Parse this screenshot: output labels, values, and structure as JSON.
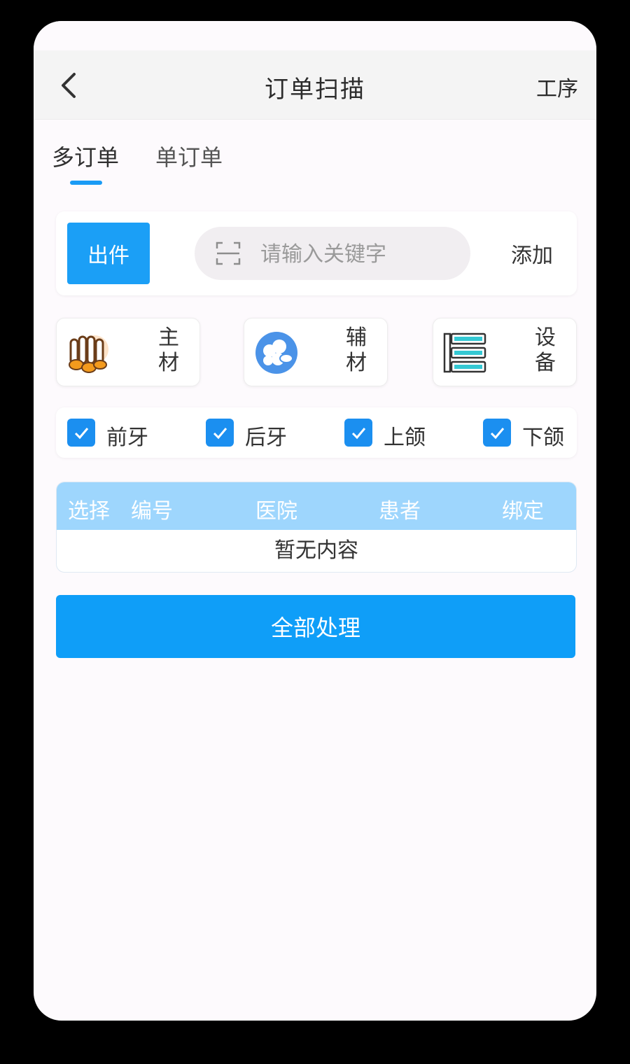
{
  "header": {
    "title": "订单扫描",
    "right_action": "工序"
  },
  "tabs": [
    {
      "label": "多订单",
      "active": true
    },
    {
      "label": "单订单",
      "active": false
    }
  ],
  "scan": {
    "out_button": "出件",
    "placeholder": "请输入关键字",
    "add_button": "添加"
  },
  "materials": [
    {
      "label_line1": "主",
      "label_line2": "材",
      "icon": "main-material-icon"
    },
    {
      "label_line1": "辅",
      "label_line2": "材",
      "icon": "auxiliary-material-icon"
    },
    {
      "label_line1": "设",
      "label_line2": "备",
      "icon": "equipment-server-icon"
    }
  ],
  "filters": [
    {
      "label": "前牙",
      "checked": true
    },
    {
      "label": "后牙",
      "checked": true
    },
    {
      "label": "上颌",
      "checked": true
    },
    {
      "label": "下颌",
      "checked": true
    }
  ],
  "table": {
    "columns": [
      "选择",
      "编号",
      "医院",
      "患者",
      "绑定"
    ],
    "empty_text": "暂无内容"
  },
  "process_button": "全部处理",
  "colors": {
    "primary": "#1b9ff6",
    "table_header": "#9ed6fd",
    "checkbox": "#1b8ff0"
  }
}
